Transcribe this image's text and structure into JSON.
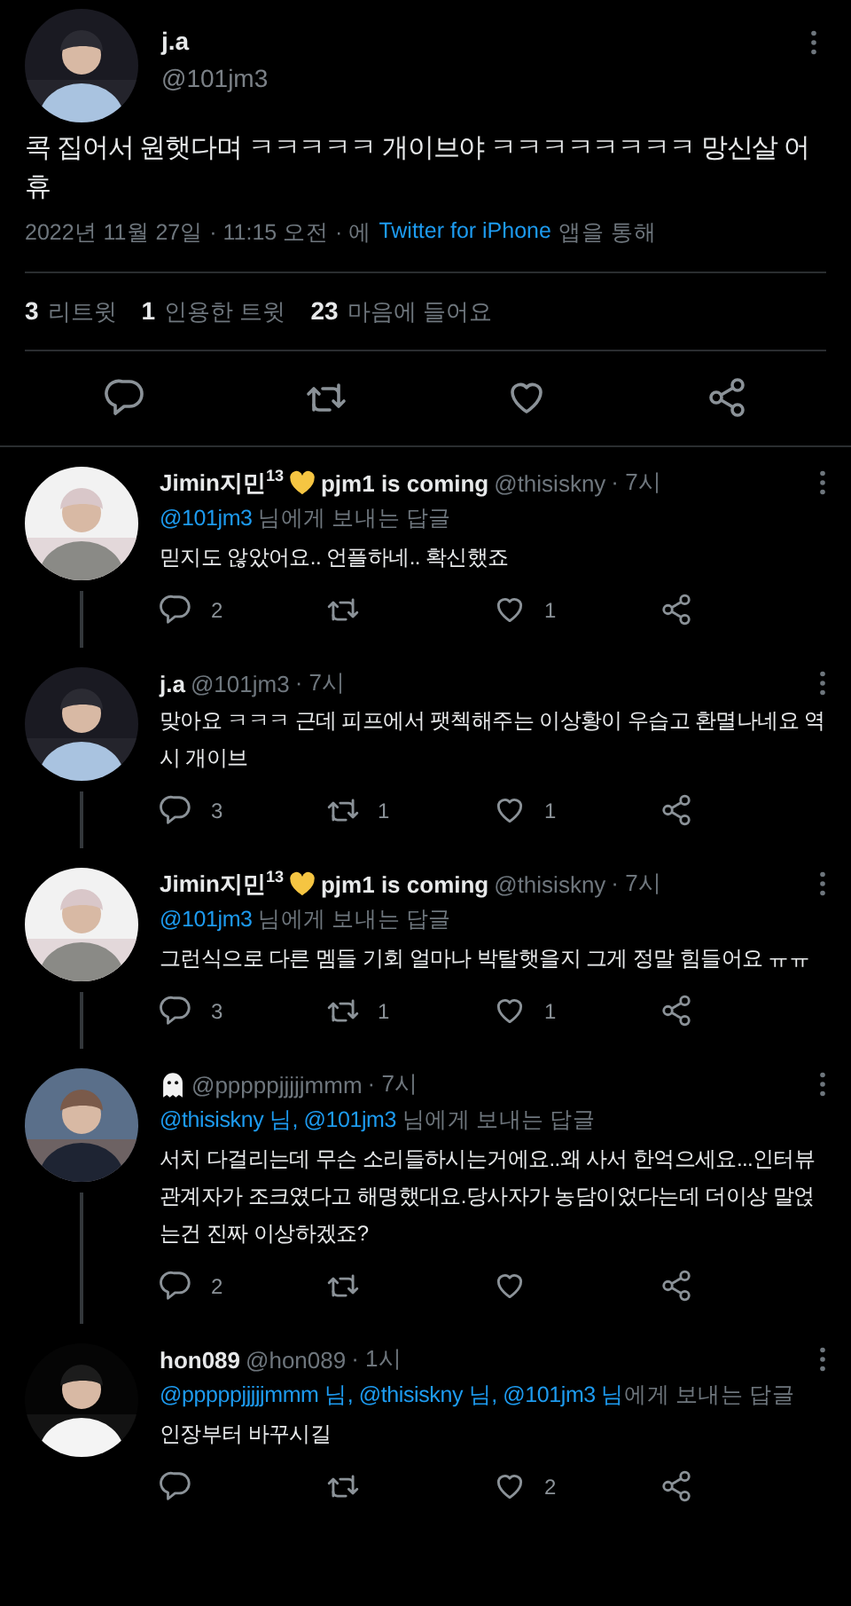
{
  "main_tweet": {
    "display_name": "j.a",
    "handle": "@101jm3",
    "text": "콕 집어서 원햇다며 ㅋㅋㅋㅋㅋ 개이브야 ㅋㅋㅋㅋㅋㅋㅋㅋ 망신살 어휴",
    "timestamp": "2022년 11월 27일 · 11:15 오전 · 에",
    "source": "Twitter for iPhone",
    "source_suffix": "앱을 통해",
    "stats": [
      {
        "count": "3",
        "label": "리트윗"
      },
      {
        "count": "1",
        "label": "인용한 트윗"
      },
      {
        "count": "23",
        "label": "마음에 들어요"
      }
    ]
  },
  "replies": [
    {
      "name_parts": [
        {
          "kind": "text",
          "text": "Jimin지민$^{13}$"
        },
        {
          "kind": "heart"
        },
        {
          "kind": "text",
          "text": "pjm1 is coming"
        }
      ],
      "handle": "@thisiskny",
      "time": "· 7시",
      "reply_to": {
        "mentions": "@101jm3",
        "rest": " 님에게 보내는 답글"
      },
      "text": "믿지도 않았어요.. 언플하네.. 확신했죠",
      "replies": "2",
      "likes": "1",
      "thread_continues": true
    },
    {
      "name_parts": [
        {
          "kind": "text",
          "text": "j.a"
        }
      ],
      "handle": "@101jm3",
      "time": "· 7시",
      "text": "맞아요 ㅋㅋㅋ 근데 피프에서 팻첵해주는 이상황이 우습고 환멸나네요 역시 개이브",
      "replies": "3",
      "retweets": "1",
      "likes": "1",
      "thread_continues": true
    },
    {
      "name_parts": [
        {
          "kind": "text",
          "text": "Jimin지민$^{13}$"
        },
        {
          "kind": "heart"
        },
        {
          "kind": "text",
          "text": "pjm1 is coming"
        }
      ],
      "handle": "@thisiskny",
      "time": "· 7시",
      "reply_to": {
        "mentions": "@101jm3",
        "rest": " 님에게 보내는 답글"
      },
      "text": "그런식으로 다른 멤들 기회 얼마나 박탈햇을지 그게 정말 힘들어요 ㅠㅠ",
      "replies": "3",
      "retweets": "1",
      "likes": "1",
      "thread_continues": true
    },
    {
      "name_parts": [
        {
          "kind": "ghost"
        }
      ],
      "handle": "@pppppjjjjjmmm",
      "time": "· 7시",
      "reply_to": {
        "mentions": "@thisiskny 님, @101jm3",
        "rest": " 님에게 보내는 답글"
      },
      "text": "서치 다걸리는데 무슨 소리들하시는거에요..왜 사서 한억으세요...인터뷰 관계자가 조크였다고 해명했대요.당사자가 농담이었다는데 더이상 말얹는건 진짜 이상하겠죠?",
      "replies": "2",
      "thread_continues": true
    },
    {
      "name_parts": [
        {
          "kind": "text",
          "text": "hon089"
        }
      ],
      "handle": "@hon089",
      "time": "· 1시",
      "reply_to": {
        "mentions": "@pppppjjjjjmmm 님, @thisiskny 님, @101jm3 님",
        "rest": "에게 보내는 답글"
      },
      "text": "인장부터 바꾸시길",
      "likes": "2",
      "thread_continues": false
    }
  ]
}
